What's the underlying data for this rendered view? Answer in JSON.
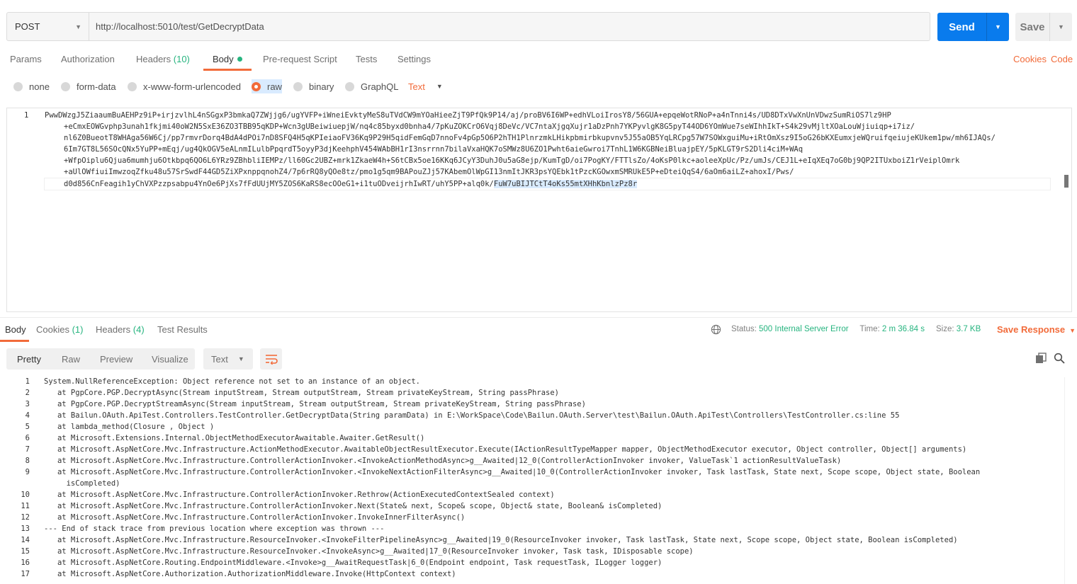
{
  "request": {
    "method": "POST",
    "url": "http://localhost:5010/test/GetDecryptData",
    "send_label": "Send",
    "save_label": "Save"
  },
  "request_tabs": [
    {
      "label": "Params"
    },
    {
      "label": "Authorization"
    },
    {
      "label": "Headers",
      "count": "(10)"
    },
    {
      "label": "Body"
    },
    {
      "label": "Pre-request Script"
    },
    {
      "label": "Tests"
    },
    {
      "label": "Settings"
    }
  ],
  "links": {
    "cookies": "Cookies",
    "code": "Code"
  },
  "body_types": [
    {
      "label": "none"
    },
    {
      "label": "form-data"
    },
    {
      "label": "x-www-form-urlencoded"
    },
    {
      "label": "raw"
    },
    {
      "label": "binary"
    },
    {
      "label": "GraphQL"
    }
  ],
  "body_format": "Text",
  "editor": {
    "line_number": "1",
    "lines": [
      "PwwDWzgJ5ZiaaumBuAEHPz9iP+irjzvlhL4nSGgxP3bmkaQ7ZWjjg6/ugYVFP+iWneiEvktyMeS8uTVdCW9mYOaHieeZjT9PfQk9P14/aj/proBV6I6WP+edhVLoiIrosY8/56GUA+epqeWotRNoP+a4nTnni4s/UD8DTxVwXnUnVDwzSumRiOS7lz9HP",
      "+eCmxEOWGvphp3unah1fkjmi40oW2N5SxE36ZO3TBB95qKDP+Wcn3gUBeiwiuepjW/nq4c85byxd0bnha4/7pKuZOKCrO6Vqj8DeVc/VC7ntaXjgqXujr1aDzPnh7YKPyvlgK8G5pyT44OD6YOmWue7seWIhhIkT+S4k29vMjltXOaLouWjiuiqp+i7iz/",
      "nl6Z0BueotT8WHAga56W6Cj/pp7rmvrDorq4BdA4dPOi7nD8SFQ4H5qKPIeiaoFV36Kq9P29H5qidFemGqD7nnoFv4pGp5O6P2hTH1Plnrzmk",
      "LHikpbmirbkupvnv5J55aOB5YqLRCpg57W7SOWxguiMu+iRtOmXsz9I5oG26bKXEumxjeWQruifqeiujeKUkem1pw/mh6IJAQs/",
      "6Im7GT8L56SOcQNx5YuPP+mEqj/ug4QkOGV5eALnmILulbPpqrdT5oyyP3djKeehphV454WAbBH1rI3nsrrnn7bilaVxaHQK7oSMWz8U6ZO1Pwht6aieGwroi7TnhL1W6KGBNeiBluajpEY/5pKLGT9rS2Dli4ciM+WAq",
      "+WfpOiplu6Qjua6mumhju6Otkbpq6QO6L6YRz9ZBhbliIEMPz/ll60Gc2UBZ+mrk1ZkaeW4h+S6tCBx5oe16KKq6JCyY3DuhJ0u5aG8ejp/KumTgD/oi7PogKY/FTTlsZo/4oKsP0lkc+aoleeXpUc/Pz/umJs/CEJ1L+eIqXEq7oG0bj9QP2ITUxboiZ1rVeiplOmrk",
      "+aUlOWfiuiImwzoqZfku48u57SrSwdF44GD5ZiXPxnppqnohZ4/7p6rRQ8yQOe8tz/pmo1g5qm9BAPouZJj57KAbemOlWpGI13nmItJKR3psYQEbk1tPzcKGOwxmSMRUkE5P+eDteiQqS4/6aOm6aiLZ+ahoxI/Pws/",
      "d0d856CnFeagih1yChVXPzzpsabpu4YnOe6PjXs7fFdUUjMY5ZOS6KaRS8ecOOeG1+i1tuODveijrhIwRT/uhY5PP+alq0k/",
      "FuW7uBIJTCtT4oKs55mtXHhKbnlzPz8r"
    ]
  },
  "response_tabs": [
    {
      "label": "Body"
    },
    {
      "label": "Cookies",
      "count": "(1)"
    },
    {
      "label": "Headers",
      "count": "(4)"
    },
    {
      "label": "Test Results"
    }
  ],
  "response_status": {
    "status_label": "Status:",
    "status": "500 Internal Server Error",
    "time_label": "Time:",
    "time": "2 m 36.84 s",
    "size_label": "Size:",
    "size": "3.7 KB",
    "save_response": "Save Response"
  },
  "response_view": {
    "modes": [
      "Pretty",
      "Raw",
      "Preview",
      "Visualize"
    ],
    "format": "Text"
  },
  "response_lines": [
    {
      "n": "1",
      "text": "System.NullReferenceException: Object reference not set to an instance of an object."
    },
    {
      "n": "2",
      "text": "   at PgpCore.PGP.DecryptAsync(Stream inputStream, Stream outputStream, Stream privateKeyStream, String passPhrase)"
    },
    {
      "n": "3",
      "text": "   at PgpCore.PGP.DecryptStreamAsync(Stream inputStream, Stream outputStream, Stream privateKeyStream, String passPhrase)"
    },
    {
      "n": "4",
      "text": "   at Bailun.OAuth.ApiTest.Controllers.TestController.GetDecryptData(String paramData) in E:\\WorkSpace\\Code\\Bailun.OAuth.Server\\test\\Bailun.OAuth.ApiTest\\Controllers\\TestController.cs:line 55"
    },
    {
      "n": "5",
      "text": "   at lambda_method(Closure , Object )"
    },
    {
      "n": "6",
      "text": "   at Microsoft.Extensions.Internal.ObjectMethodExecutorAwaitable.Awaiter.GetResult()"
    },
    {
      "n": "7",
      "text": "   at Microsoft.AspNetCore.Mvc.Infrastructure.ActionMethodExecutor.AwaitableObjectResultExecutor.Execute(IActionResultTypeMapper mapper, ObjectMethodExecutor executor, Object controller, Object[] arguments)"
    },
    {
      "n": "8",
      "text": "   at Microsoft.AspNetCore.Mvc.Infrastructure.ControllerActionInvoker.<InvokeActionMethodAsync>g__Awaited|12_0(ControllerActionInvoker invoker, ValueTask`1 actionResultValueTask)"
    },
    {
      "n": "9",
      "text": "   at Microsoft.AspNetCore.Mvc.Infrastructure.ControllerActionInvoker.<InvokeNextActionFilterAsync>g__Awaited|10_0(ControllerActionInvoker invoker, Task lastTask, State next, Scope scope, Object state, Boolean"
    },
    {
      "n": "",
      "text": "     isCompleted)"
    },
    {
      "n": "10",
      "text": "   at Microsoft.AspNetCore.Mvc.Infrastructure.ControllerActionInvoker.Rethrow(ActionExecutedContextSealed context)"
    },
    {
      "n": "11",
      "text": "   at Microsoft.AspNetCore.Mvc.Infrastructure.ControllerActionInvoker.Next(State& next, Scope& scope, Object& state, Boolean& isCompleted)"
    },
    {
      "n": "12",
      "text": "   at Microsoft.AspNetCore.Mvc.Infrastructure.ControllerActionInvoker.InvokeInnerFilterAsync()"
    },
    {
      "n": "13",
      "text": "--- End of stack trace from previous location where exception was thrown ---"
    },
    {
      "n": "14",
      "text": "   at Microsoft.AspNetCore.Mvc.Infrastructure.ResourceInvoker.<InvokeFilterPipelineAsync>g__Awaited|19_0(ResourceInvoker invoker, Task lastTask, State next, Scope scope, Object state, Boolean isCompleted)"
    },
    {
      "n": "15",
      "text": "   at Microsoft.AspNetCore.Mvc.Infrastructure.ResourceInvoker.<InvokeAsync>g__Awaited|17_0(ResourceInvoker invoker, Task task, IDisposable scope)"
    },
    {
      "n": "16",
      "text": "   at Microsoft.AspNetCore.Routing.EndpointMiddleware.<Invoke>g__AwaitRequestTask|6_0(Endpoint endpoint, Task requestTask, ILogger logger)"
    },
    {
      "n": "17",
      "text": "   at Microsoft.AspNetCore.Authorization.AuthorizationMiddleware.Invoke(HttpContext context)"
    }
  ]
}
